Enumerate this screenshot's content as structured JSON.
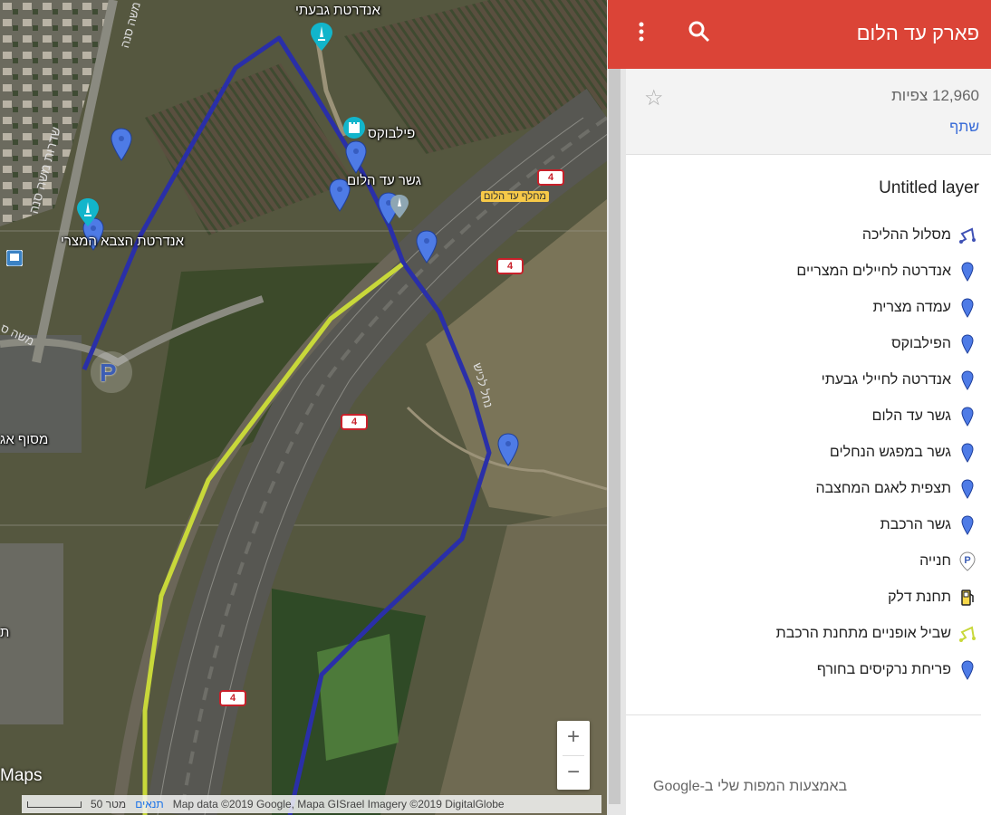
{
  "map": {
    "labels": {
      "givati_monument": "אנדרטת גבעתי",
      "pillbox": "פילבוקס",
      "bridge": "גשר עד הלום",
      "egypt_monument": "אנדרטת הצבא המצרי",
      "exit": "מחלף עד הלום",
      "avenue": "שדרות משה סנה",
      "street_top": "משה סנה",
      "street_left": "משה ס",
      "terminal": "מסוף אג",
      "stream": "נחל לכיש",
      "cut_left": "ת"
    },
    "road_number": "4",
    "zoom_in": "+",
    "zoom_out": "−",
    "maps_logo": "Maps",
    "scale_text": "50 מטר",
    "terms": "תנאים",
    "attribution": "Map data ©2019 Google, Mapa GISrael Imagery ©2019 DigitalGlobe"
  },
  "panel": {
    "title": "פארק עד הלום",
    "views": "12,960 צפיות",
    "share": "שתף",
    "layer_title": "Untitled layer",
    "items": [
      {
        "label": "מסלול ההליכה",
        "icon": "route-icon",
        "color": "#3f51b5"
      },
      {
        "label": "אנדרטה לחיילים המצריים",
        "icon": "pin-icon",
        "color": "#4e7be6"
      },
      {
        "label": "עמדה מצרית",
        "icon": "pin-icon",
        "color": "#4e7be6"
      },
      {
        "label": "הפילבוקס",
        "icon": "pin-icon",
        "color": "#4e7be6"
      },
      {
        "label": "אנדרטה לחיילי גבעתי",
        "icon": "pin-icon",
        "color": "#4e7be6"
      },
      {
        "label": "גשר עד הלום",
        "icon": "pin-icon",
        "color": "#4e7be6"
      },
      {
        "label": "גשר במפגש הנחלים",
        "icon": "pin-icon",
        "color": "#4e7be6"
      },
      {
        "label": "תצפית לאגם המחצבה",
        "icon": "pin-icon",
        "color": "#4e7be6"
      },
      {
        "label": "גשר הרכבת",
        "icon": "pin-icon",
        "color": "#4e7be6"
      },
      {
        "label": "חנייה",
        "icon": "parking-icon",
        "color": "#3d5eb4"
      },
      {
        "label": "תחנת דלק",
        "icon": "fuel-icon",
        "color": "#222222"
      },
      {
        "label": "שביל אופניים מתחנת הרכבת",
        "icon": "route-icon",
        "color": "#c8d83a"
      },
      {
        "label": "פריחת נרקיסים בחורף",
        "icon": "pin-icon",
        "color": "#4e7be6"
      }
    ],
    "footer": "באמצעות המפות שלי ב-Google"
  },
  "colors": {
    "header": "#db4437",
    "walking_route": "#2a2fa8",
    "bike_route": "#c8d83a",
    "pin": "#4e7be6"
  }
}
